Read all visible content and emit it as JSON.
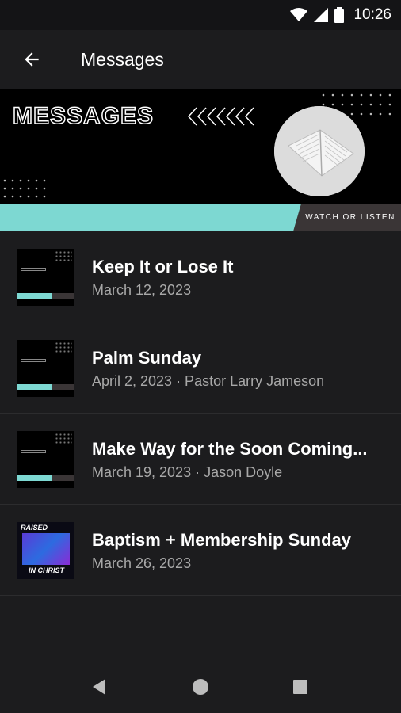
{
  "status_bar": {
    "time": "10:26",
    "icons": [
      "wifi-icon",
      "signal-icon",
      "battery-icon"
    ]
  },
  "app_bar": {
    "title": "Messages",
    "back_icon": "arrow-back-icon"
  },
  "banner": {
    "title": "MESSAGES",
    "cta": "WATCH OR LISTEN"
  },
  "messages": [
    {
      "title": "Keep It or Lose It",
      "subtitle": "March 12, 2023",
      "thumbnail": "messages-banner"
    },
    {
      "title": "Palm Sunday",
      "subtitle": "April 2, 2023 · Pastor Larry Jameson",
      "thumbnail": "messages-banner"
    },
    {
      "title": "Make Way for the Soon Coming...",
      "subtitle": "March 19, 2023 · Jason Doyle",
      "thumbnail": "messages-banner"
    },
    {
      "title": "Baptism + Membership Sunday",
      "subtitle": "March 26, 2023",
      "thumbnail": "raised-in-christ",
      "thumb_top": "RAISED",
      "thumb_bottom": "IN CHRIST"
    }
  ],
  "nav_bar": {
    "buttons": [
      "back-triangle-icon",
      "home-circle-icon",
      "recents-square-icon"
    ]
  },
  "colors": {
    "background": "#1c1c1e",
    "accent": "#7dd8d2",
    "subtitle": "#a8a8a8"
  }
}
